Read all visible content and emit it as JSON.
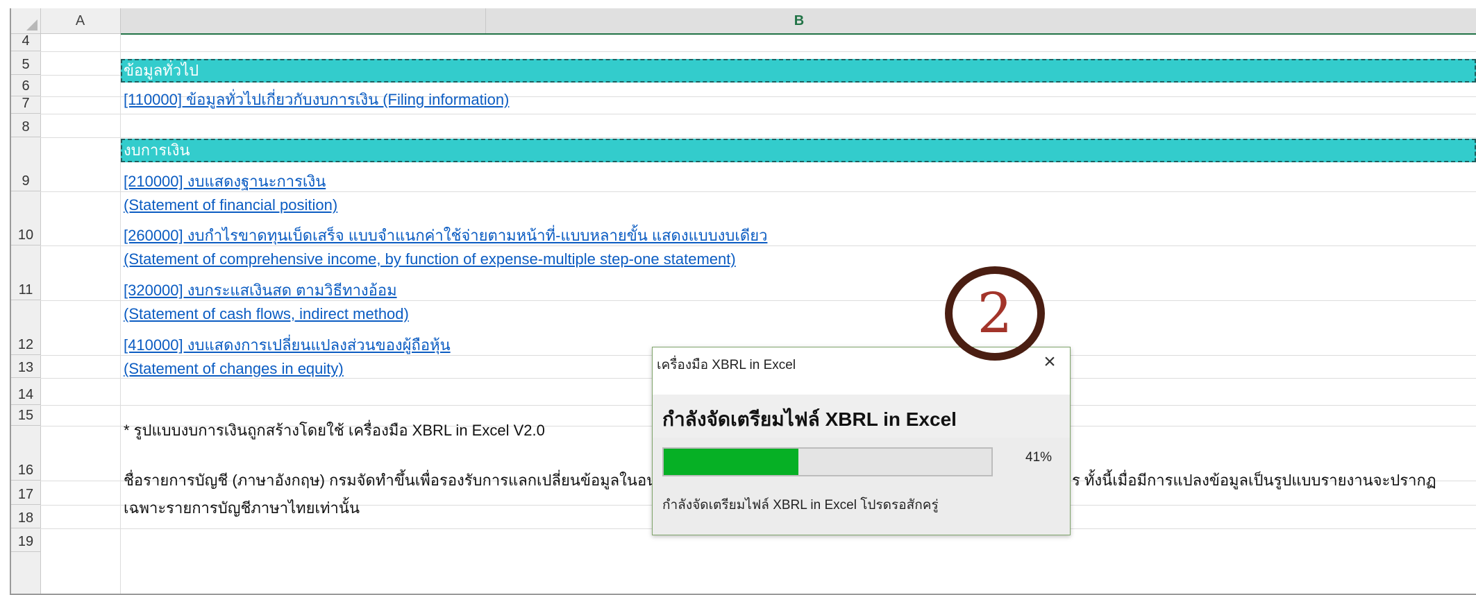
{
  "columns": {
    "a": "A",
    "b": "B"
  },
  "rows": [
    "4",
    "5",
    "6",
    "7",
    "8",
    "9",
    "10",
    "11",
    "12",
    "13",
    "14",
    "15",
    "16",
    "17",
    "18",
    "19"
  ],
  "cells": {
    "r5": "ข้อมูลทั่วไป",
    "r6": "[110000] ข้อมูลทั่วไปเกี่ยวกับงบการเงิน (Filing information)",
    "r8": "งบการเงิน",
    "r9a": "[210000] งบแสดงฐานะการเงิน",
    "r9b": "(Statement of financial position)",
    "r10a": "[260000] งบกำไรขาดทุนเบ็ดเสร็จ แบบจำแนกค่าใช้จ่ายตามหน้าที่-แบบหลายขั้น แสดงแบบงบเดียว",
    "r10b": "(Statement of comprehensive income, by function of expense-multiple step-one statement)",
    "r11a": "[320000] งบกระแสเงินสด ตามวิธีทางอ้อม",
    "r11b": "(Statement of cash flows, indirect method)",
    "r12a": "[410000] งบแสดงการเปลี่ยนแปลงส่วนของผู้ถือหุ้น",
    "r12b": "(Statement of changes in equity)",
    "r14": "* รูปแบบงบการเงินถูกสร้างโดยใช้ เครื่องมือ XBRL in Excel V2.0",
    "r16a_left": "ชื่อรายการบัญชี (ภาษาอังกฤษ) กรมจัดทำขึ้นเพื่อรองรับการแลกเปลี่ยนข้อมูลในอนา",
    "r16a_right": "ร ทั้งนี้เมื่อมีการแปลงข้อมูลเป็นรูปแบบรายงานจะปรากฏ",
    "r16b": "เฉพาะรายการบัญชีภาษาไทยเท่านั้น"
  },
  "dialog": {
    "title": "เครื่องมือ XBRL in Excel",
    "close": "×",
    "heading": "กำลังจัดเตรียมไฟล์ XBRL in Excel",
    "progress_value": 41,
    "progress_label": "41%",
    "status": "กำลังจัดเตรียมไฟล์ XBRL in Excel โปรดรอสักครู่"
  },
  "annotation": {
    "step": "2"
  },
  "colors": {
    "section_fill": "#33cccc",
    "link": "#0b5cc2",
    "progress": "#06b025",
    "annotation": "#4a1e12"
  }
}
